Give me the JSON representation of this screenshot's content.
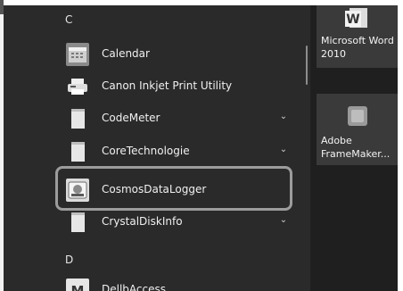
{
  "start_menu": {
    "sections": [
      {
        "letter": "C"
      },
      {
        "letter": "D"
      }
    ],
    "apps": [
      {
        "label": "Calendar",
        "expandable": false,
        "icon": "calendar-icon"
      },
      {
        "label": "Canon Inkjet Print Utility",
        "expandable": false,
        "icon": "printer-icon"
      },
      {
        "label": "CodeMeter",
        "expandable": true,
        "icon": "folder-icon"
      },
      {
        "label": "CoreTechnologie",
        "expandable": true,
        "icon": "folder-icon"
      },
      {
        "label": "CosmosDataLogger",
        "expandable": false,
        "highlighted": true,
        "icon": "data-logger-icon"
      },
      {
        "label": "CrystalDiskInfo",
        "expandable": true,
        "icon": "folder-icon"
      },
      {
        "label": "DellbAccess",
        "expandable": false,
        "icon": "app-icon"
      }
    ]
  },
  "tiles": [
    {
      "label": "Microsoft Word 2010",
      "icon": "word-icon"
    },
    {
      "label": "Adobe FrameMaker...",
      "icon": "framemaker-icon"
    }
  ],
  "colors": {
    "background": "#2a2a2a",
    "text": "#f0f0f0",
    "highlight_border": "#9c9c9c"
  }
}
